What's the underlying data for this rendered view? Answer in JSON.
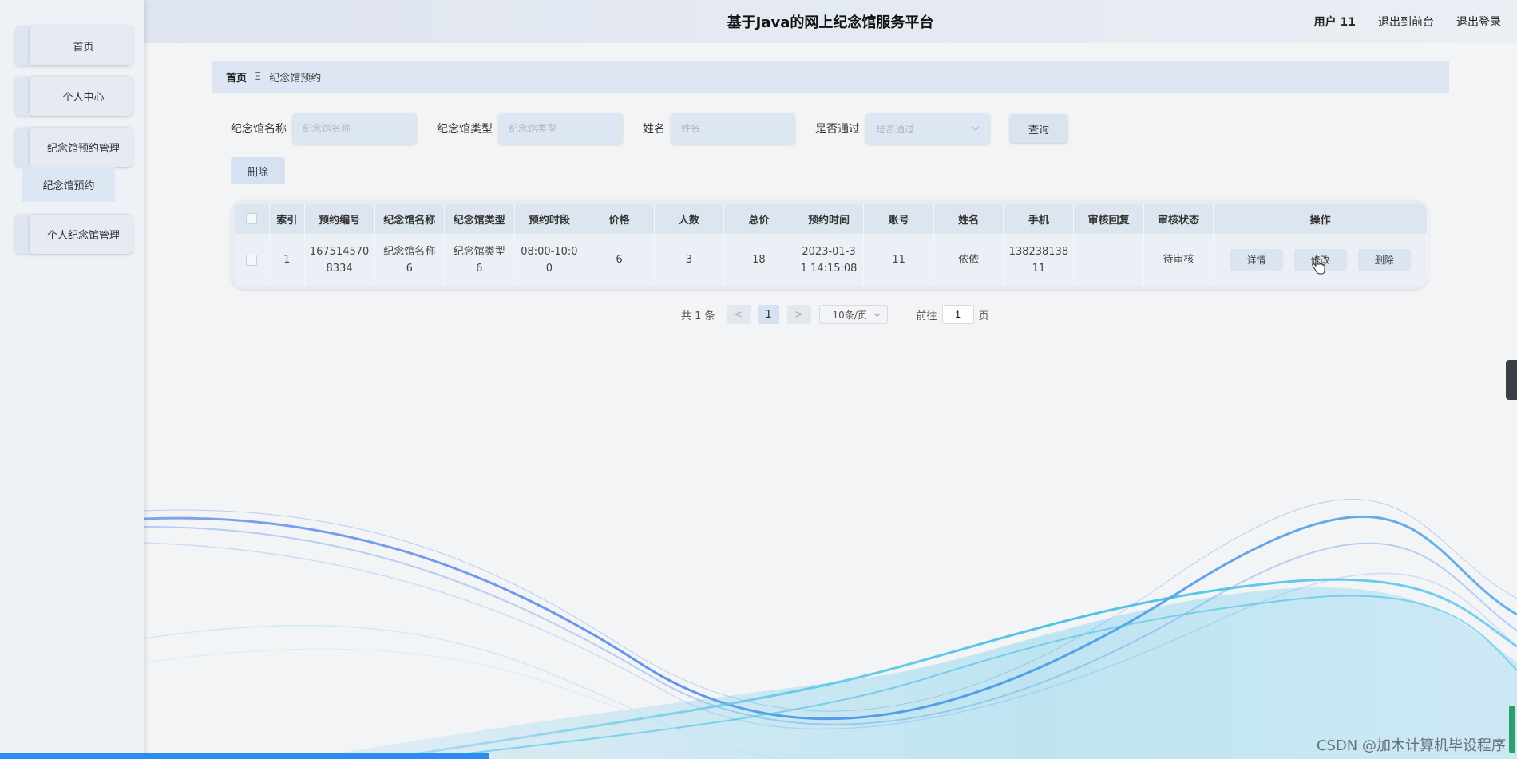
{
  "header": {
    "title": "基于Java的网上纪念馆服务平台",
    "user": "用户 11",
    "to_front": "退出到前台",
    "logout": "退出登录"
  },
  "sidebar": {
    "items": [
      {
        "label": "首页"
      },
      {
        "label": "个人中心"
      },
      {
        "label": "纪念馆预约管理"
      },
      {
        "label": "个人纪念馆管理"
      }
    ],
    "sub_item": "纪念馆预约"
  },
  "breadcrumb": {
    "home": "首页",
    "separator": "Ξ",
    "current": "纪念馆预约"
  },
  "search": {
    "name_label": "纪念馆名称",
    "name_placeholder": "纪念馆名称",
    "type_label": "纪念馆类型",
    "type_placeholder": "纪念馆类型",
    "person_label": "姓名",
    "person_placeholder": "姓名",
    "pass_label": "是否通过",
    "pass_placeholder": "是否通过",
    "query_button": "查询"
  },
  "toolbar": {
    "delete_button": "删除"
  },
  "table": {
    "headers": [
      "索引",
      "预约编号",
      "纪念馆名称",
      "纪念馆类型",
      "预约时段",
      "价格",
      "人数",
      "总价",
      "预约时间",
      "账号",
      "姓名",
      "手机",
      "审核回复",
      "审核状态",
      "操作"
    ],
    "rows": [
      {
        "index": "1",
        "booking_no_1": "167514570",
        "booking_no_2": "8334",
        "hall_name_1": "纪念馆名称",
        "hall_name_2": "6",
        "hall_type_1": "纪念馆类型",
        "hall_type_2": "6",
        "slot_1": "08:00-10:0",
        "slot_2": "0",
        "price": "6",
        "people": "3",
        "total": "18",
        "time_1": "2023-01-3",
        "time_2": "1 14:15:08",
        "account": "11",
        "name": "依依",
        "phone_1": "138238138",
        "phone_2": "11",
        "reply": "",
        "status": "待审核",
        "actions": {
          "detail": "详情",
          "edit": "修改",
          "delete": "删除"
        }
      }
    ]
  },
  "pagination": {
    "total": "共 1 条",
    "prev": "<",
    "current_page": "1",
    "next": ">",
    "page_size": "10条/页",
    "goto_label": "前往",
    "goto_value": "1",
    "page_suffix": "页"
  },
  "watermark": "CSDN @加木计算机毕设程序",
  "colors": {
    "accent": "#2d8cf0",
    "sidebar_bg": "#eef1f6",
    "header_bg": "#dfe5ef"
  }
}
